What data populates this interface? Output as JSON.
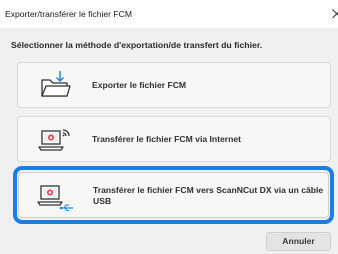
{
  "window": {
    "title": "Exporter/transférer le fichier FCM"
  },
  "dialog": {
    "instruction": "Sélectionner la méthode d'exportation/de transfert du fichier.",
    "options": [
      {
        "label": "Exporter le fichier FCM",
        "icon": "folder-export-icon"
      },
      {
        "label": "Transférer le fichier FCM via Internet",
        "icon": "laptop-wireless-icon"
      },
      {
        "label": "Transférer le fichier FCM vers ScanNCut DX via un câble USB",
        "icon": "laptop-usb-icon",
        "selected": true
      }
    ],
    "cancel_label": "Annuler"
  },
  "colors": {
    "selection_ring": "#1a7ee6",
    "dialog_background": "#f0f0f0",
    "option_background": "#f7f7f7"
  }
}
